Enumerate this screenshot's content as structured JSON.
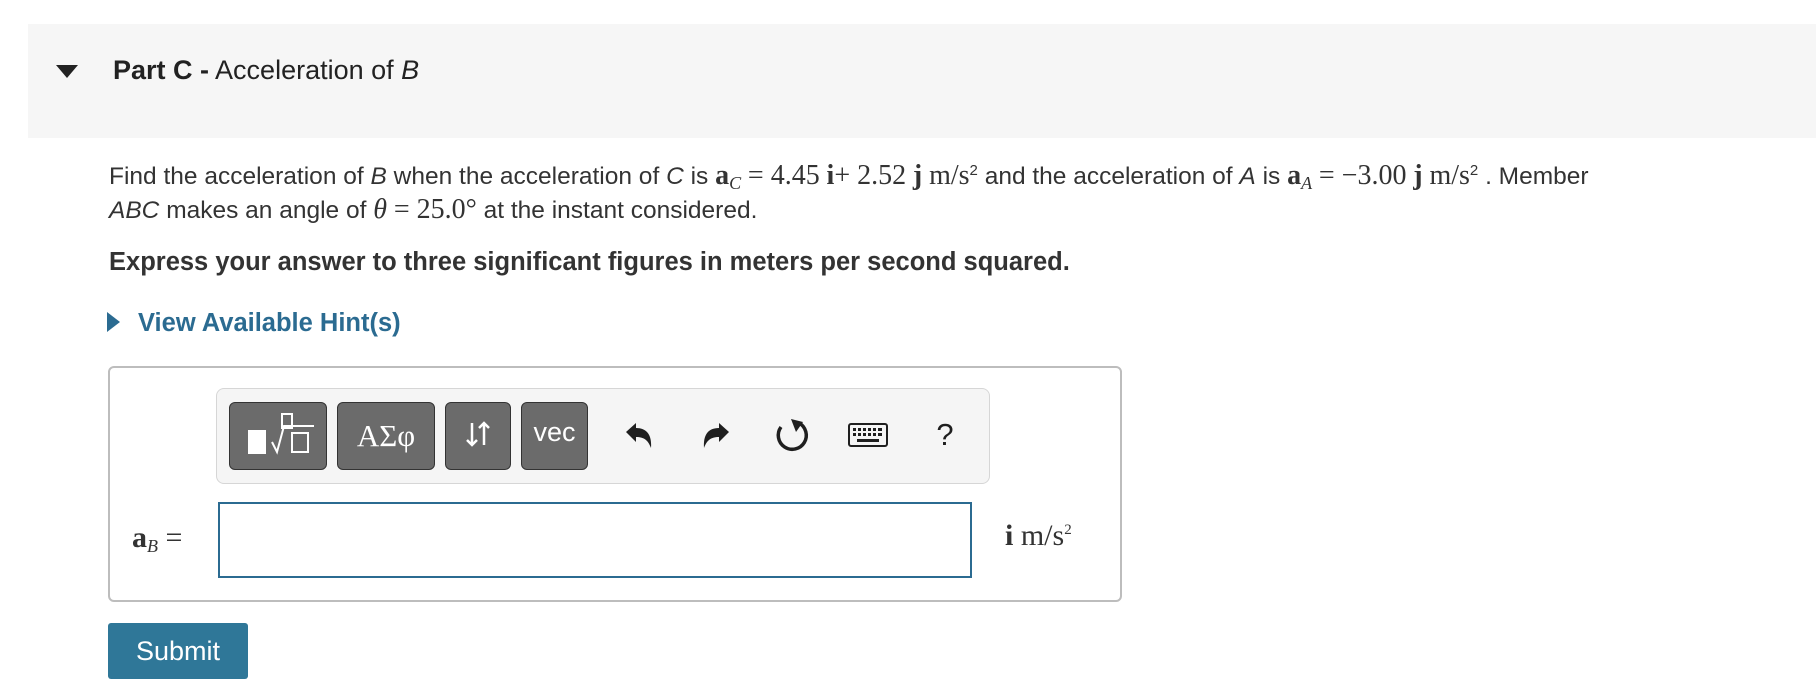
{
  "part": {
    "label": "Part C -",
    "title": "Acceleration of",
    "title_var": "B"
  },
  "problem": {
    "t1": "Find the acceleration of",
    "t2": "B",
    "t3": "when the acceleration of",
    "t4": "C",
    "t5": "is",
    "aC_sym": "a",
    "aC_sub": "C",
    "aC_val": "= 4.45",
    "i": "i",
    "plus": "+ 2.52",
    "j": "j",
    "unit1": "m/s",
    "sq": "2",
    "t6": "and the acceleration of",
    "t7": "A",
    "t8": "is",
    "aA_sym": "a",
    "aA_sub": "A",
    "aA_val": "= −3.00",
    "unit2": "m/s",
    "t9": ". Member",
    "t10": "ABC",
    "t11": "makes an angle of",
    "theta": "θ",
    "theta_val": "= 25.0°",
    "t12": "at the instant considered."
  },
  "instruction": "Express your answer to three significant figures in meters per second squared.",
  "hint": "View Available Hint(s)",
  "toolbar": {
    "greek": "ΑΣφ",
    "vec": "vec",
    "help": "?"
  },
  "answer": {
    "lhs_sym": "a",
    "lhs_sub": "B",
    "lhs_eq": "=",
    "value": "",
    "unit_i": "i",
    "unit": "m/s",
    "unit_sq": "2"
  },
  "submit": "Submit",
  "colors": {
    "accent": "#2f7798",
    "link": "#2b6b91",
    "header_bg": "#f6f6f6"
  }
}
